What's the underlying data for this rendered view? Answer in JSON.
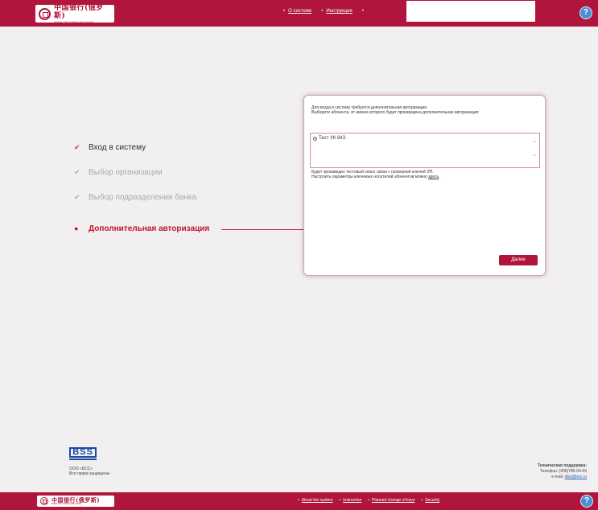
{
  "header": {
    "logo": {
      "cn": "中国银行(俄罗斯)",
      "en": "BANK OF CHINA (ELUOSI)"
    },
    "nav": [
      "О системе",
      "Инструкция"
    ],
    "bullet": "•",
    "help": "?"
  },
  "steps": [
    {
      "label": "Вход в систему",
      "mark": "✔",
      "state": "done"
    },
    {
      "label": "Выбор организации",
      "mark": "✔",
      "state": "dim"
    },
    {
      "label": "Выбор подразделения банка",
      "mark": "✔",
      "state": "dim"
    },
    {
      "label": "Дополнительная авторизация",
      "mark": "●",
      "state": "active"
    }
  ],
  "dialog": {
    "intro_line1": "Для входа в систему требуется дополнительная авторизация.",
    "intro_line2": "Выберите абонента, от имени которого будет произведена дополнительная авторизация:",
    "list_items": [
      "Тест УК 843"
    ],
    "note_line1": "Будет произведен тестовый сеанс связи с проверкой ключей ЭП.",
    "note_line2": "Настроить параметры ключевых носителей абонентов можно",
    "note_link": "здесь",
    "next_button": "Далее",
    "scroll_up": "⌃",
    "scroll_down": "⌄"
  },
  "footer": {
    "bss_logo": "BSS",
    "company": "ООО «БСС»",
    "rights": "Все права защищены",
    "support_title": "Техническая поддержка:",
    "phone": "Телефон: (495)785-04-69",
    "email_label": "e-mail:",
    "email": "dbo@boc.ru",
    "nav": [
      "About the system",
      "Instruction",
      "Planned change of keys",
      "Security"
    ]
  },
  "colors": {
    "brand": "#b0163b",
    "active": "#c0162d",
    "link": "#2a5fb0"
  }
}
